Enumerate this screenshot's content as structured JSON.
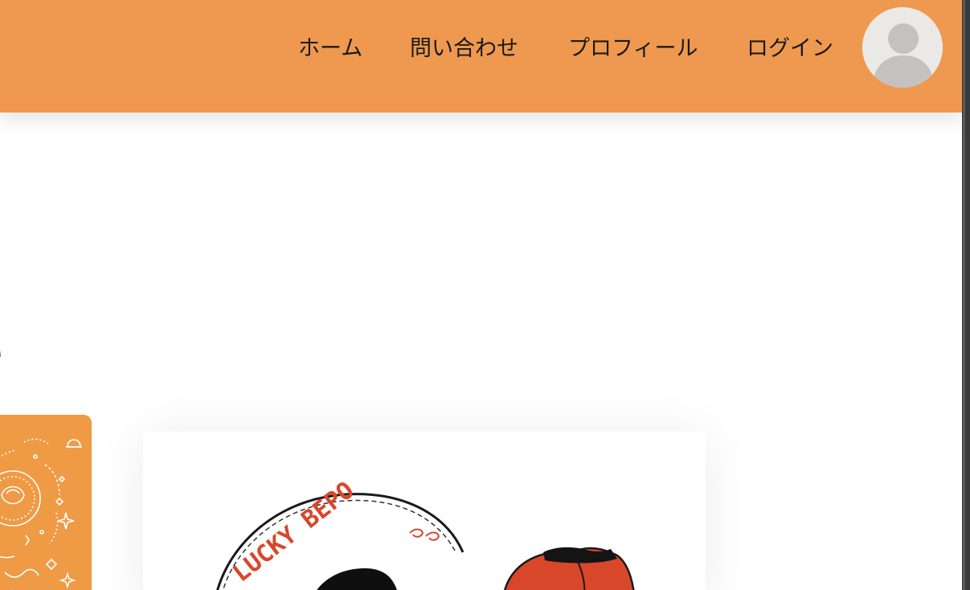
{
  "nav": {
    "items": [
      {
        "id": "home",
        "label": "ホーム"
      },
      {
        "id": "contact",
        "label": "問い合わせ"
      },
      {
        "id": "profile",
        "label": "プロフィール"
      },
      {
        "id": "login",
        "label": "ログイン"
      }
    ]
  },
  "avatar": {
    "icon": "user-avatar-icon"
  },
  "content": {
    "heading_visible_fragment": "e",
    "product_logo_text": "LUCKY BEPO"
  },
  "colors": {
    "header_bg": "#ee994f",
    "card_orange": "#ef9a45",
    "logo_red": "#d9472a"
  }
}
